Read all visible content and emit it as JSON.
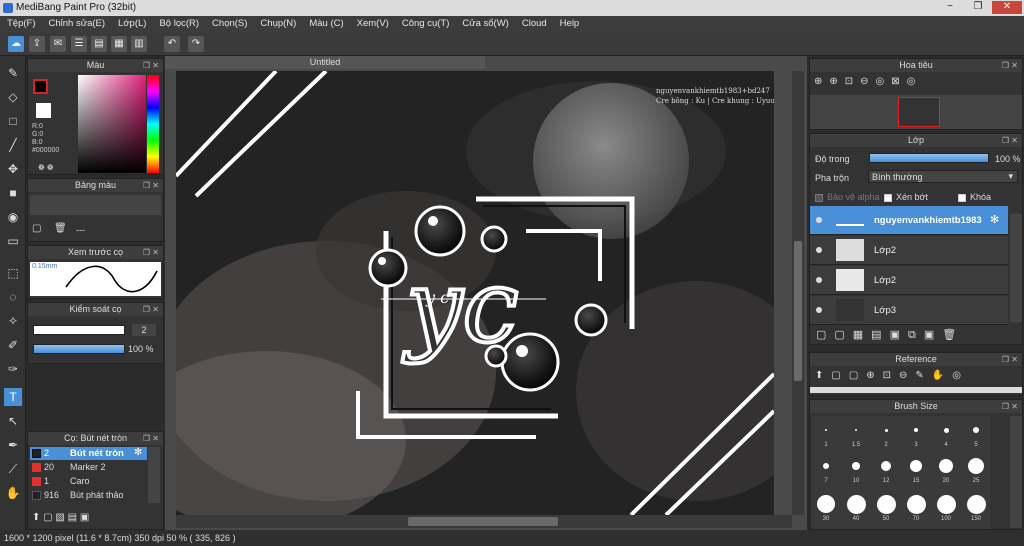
{
  "window": {
    "title": "MediBang Paint Pro (32bit)",
    "controls": [
      "−",
      "❐",
      "✕"
    ]
  },
  "menu": [
    "Tệp(F)",
    "Chỉnh sửa(E)",
    "Lớp(L)",
    "Bộ lọc(R)",
    "Chọn(S)",
    "Chụp(N)",
    "Màu (C)",
    "Xem(V)",
    "Công cụ(T)",
    "Cửa sổ(W)",
    "Cloud",
    "Help"
  ],
  "color_panel": {
    "title": "Màu",
    "r": "R:0",
    "g": "G:0",
    "b": "B:0",
    "hex": "#000000",
    "foreground": "#000000",
    "background": "#ffffff"
  },
  "swatch_panel": {
    "title": "Bảng màu",
    "value": "---"
  },
  "stroke_preview": {
    "title": "Xem trước cọ",
    "size": "0.15mm"
  },
  "brush_control": {
    "title": "Kiểm soát cọ",
    "size": "2",
    "opacity": "100 %"
  },
  "brush_list": {
    "title": "Cọ: Bút nét tròn",
    "items": [
      {
        "size": "2",
        "name": "Bút nét tròn",
        "color": "#222222"
      },
      {
        "size": "20",
        "name": "Marker 2",
        "color": "#e03030"
      },
      {
        "size": "1",
        "name": "Caro",
        "color": "#e03030"
      },
      {
        "size": "916",
        "name": "Bút phát thảo",
        "color": "#222222"
      }
    ]
  },
  "document": {
    "tab": "Untitled",
    "credit_line1": "nguyenvankhiemtb1983+bd247",
    "credit_line2": "Cre bông : Ku | Cre khung : Uyuue",
    "logo_text": "yc",
    "small_text": "y c"
  },
  "navigator": {
    "title": "Hoa tiêu"
  },
  "layers_panel": {
    "title": "Lớp",
    "opacity_label": "Độ trong",
    "opacity_value": "100 %",
    "opacity_fraction": 1.0,
    "blend_label": "Pha trộn",
    "blend_value": "Bình thường",
    "protect_alpha": "Bảo vệ alpha",
    "clipping": "Xén bớt",
    "lock": "Khóa",
    "layers": [
      {
        "name": "nguyenvankhiemtb1983"
      },
      {
        "name": "Lớp2"
      },
      {
        "name": "Lớp2"
      },
      {
        "name": "Lớp3"
      }
    ]
  },
  "reference_panel": {
    "title": "Reference"
  },
  "brush_size_panel": {
    "title": "Brush Size",
    "sizes_row1": [
      "1",
      "1.5",
      "2",
      "3",
      "4",
      "5"
    ],
    "sizes_row2": [
      "7",
      "10",
      "12",
      "15",
      "20",
      "25"
    ],
    "sizes_row3": [
      "30",
      "40",
      "50",
      "70",
      "100",
      "150"
    ]
  },
  "status": {
    "size": "1600 * 1200 pixel",
    "physical": "(11.6 * 8.7cm)",
    "dpi": "350 dpi",
    "zoom": "50 %",
    "coords": "( 335, 826 )"
  }
}
